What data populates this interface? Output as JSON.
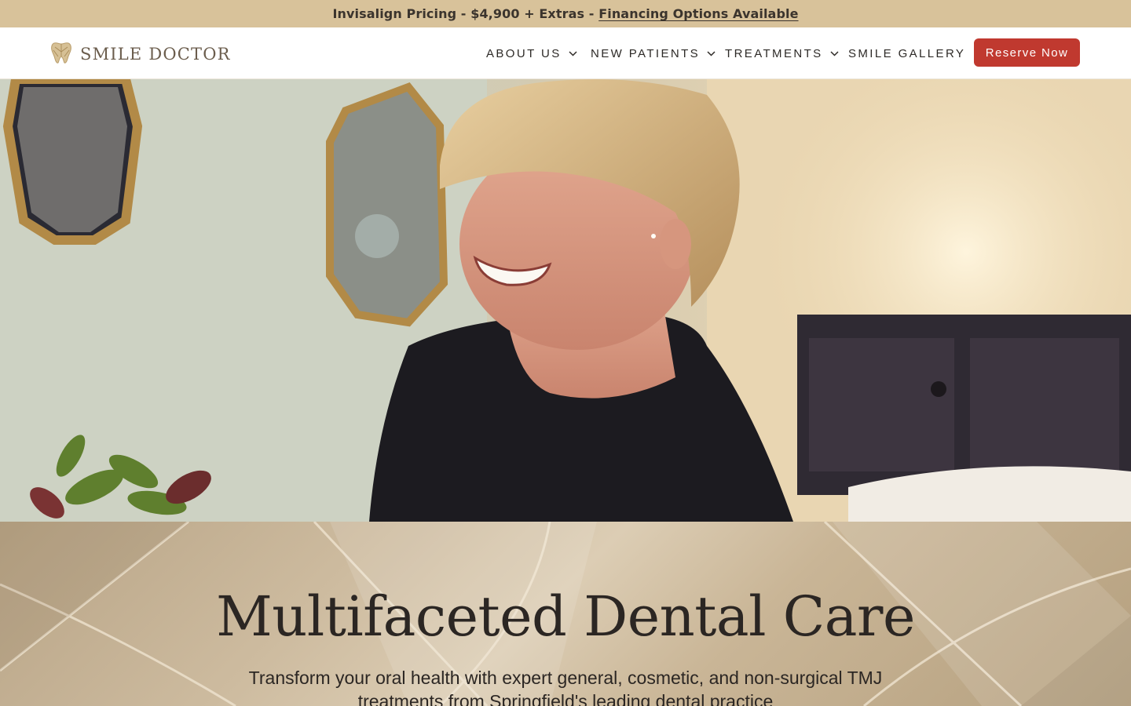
{
  "announcement": {
    "pricing_text": "Invisalign Pricing - $4,900 + Extras -",
    "financing_link": "Financing Options Available"
  },
  "header": {
    "logo_text": "SMILE DOCTOR",
    "logo_icon": "tooth-icon",
    "nav": [
      {
        "label": "ABOUT US",
        "has_dropdown": true
      },
      {
        "label": "NEW PATIENTS",
        "has_dropdown": true
      },
      {
        "label": "TREATMENTS",
        "has_dropdown": true
      },
      {
        "label": "SMILE GALLERY",
        "has_dropdown": false
      }
    ],
    "cta_label": "Reserve Now"
  },
  "hero": {
    "image_subject": "smiling-woman-photo"
  },
  "intro": {
    "title": "Multifaceted Dental Care",
    "subtitle": "Transform your oral health with expert general, cosmetic, and non-surgical TMJ treatments from Springfield's leading dental practice"
  },
  "colors": {
    "announcement_bg": "#d8c29a",
    "cta_bg": "#c0392f",
    "logo_gold": "#b99d6b"
  }
}
